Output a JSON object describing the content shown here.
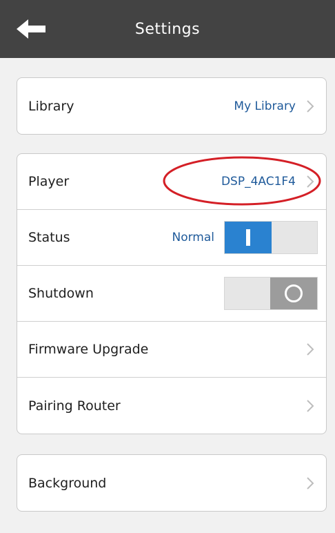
{
  "header": {
    "title": "Settings"
  },
  "library_section": {
    "label": "Library",
    "value": "My Library"
  },
  "player_section": {
    "player": {
      "label": "Player",
      "value": "DSP_4AC1F4"
    },
    "status": {
      "label": "Status",
      "value": "Normal",
      "toggle_on": true
    },
    "shutdown": {
      "label": "Shutdown",
      "toggle_on": false
    },
    "firmware": {
      "label": "Firmware Upgrade"
    },
    "pairing": {
      "label": "Pairing Router"
    }
  },
  "background_section": {
    "label": "Background"
  },
  "colors": {
    "header_bg": "#434343",
    "page_bg": "#f1f1f1",
    "accent": "#2a82d0",
    "value_text": "#1f5a9a",
    "highlight": "#d41f26"
  },
  "icons": {
    "back": "arrow-left-icon",
    "chevron": "chevron-right-icon"
  }
}
